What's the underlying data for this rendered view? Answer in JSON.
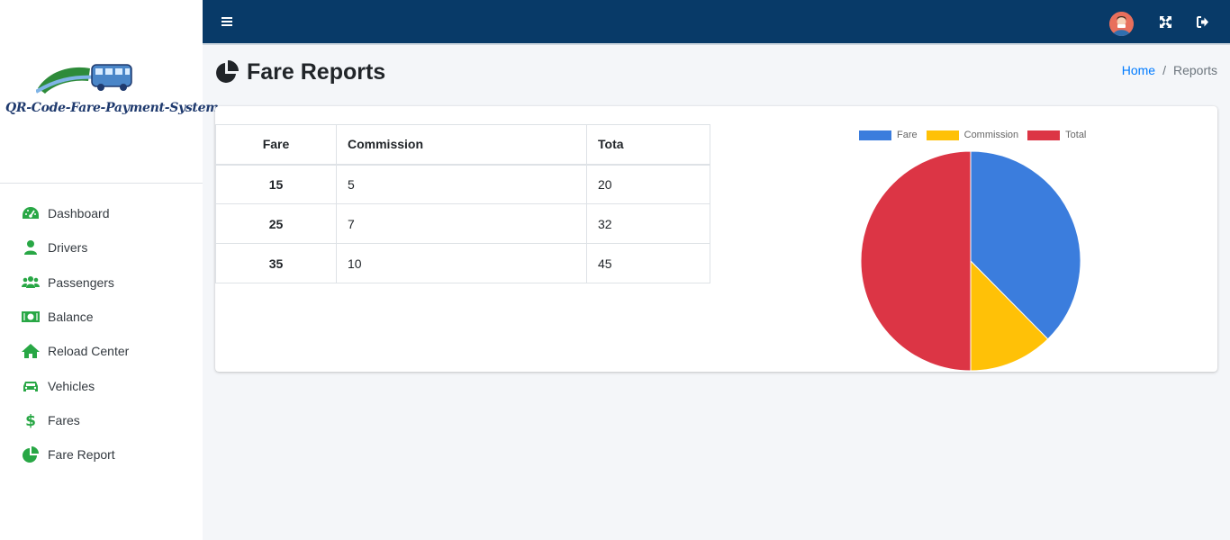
{
  "brand": {
    "text": "QR-Code-Fare-Payment-System"
  },
  "sidebar": {
    "items": [
      {
        "label": "Dashboard",
        "icon": "tachometer-icon"
      },
      {
        "label": "Drivers",
        "icon": "user-icon"
      },
      {
        "label": "Passengers",
        "icon": "users-icon"
      },
      {
        "label": "Balance",
        "icon": "money-bill-icon"
      },
      {
        "label": "Reload Center",
        "icon": "home-icon"
      },
      {
        "label": "Vehicles",
        "icon": "car-icon"
      },
      {
        "label": "Fares",
        "icon": "dollar-icon"
      },
      {
        "label": "Fare Report",
        "icon": "chart-pie-icon"
      }
    ],
    "icon_color": "#28a745"
  },
  "topbar": {
    "color": "#083a68"
  },
  "page": {
    "title": "Fare Reports"
  },
  "breadcrumb": {
    "home": "Home",
    "separator": "/",
    "current": "Reports"
  },
  "table": {
    "headers": [
      "Fare",
      "Commission",
      "Tota"
    ],
    "rows": [
      [
        "15",
        "5",
        "20"
      ],
      [
        "25",
        "7",
        "32"
      ],
      [
        "35",
        "10",
        "45"
      ]
    ]
  },
  "chart_data": {
    "type": "pie",
    "categories": [
      "Fare",
      "Commission",
      "Total"
    ],
    "values": [
      37.6,
      12.4,
      50.0
    ],
    "colors": [
      "#3b7ddd",
      "#ffc107",
      "#dc3545"
    ],
    "legend": "top"
  }
}
